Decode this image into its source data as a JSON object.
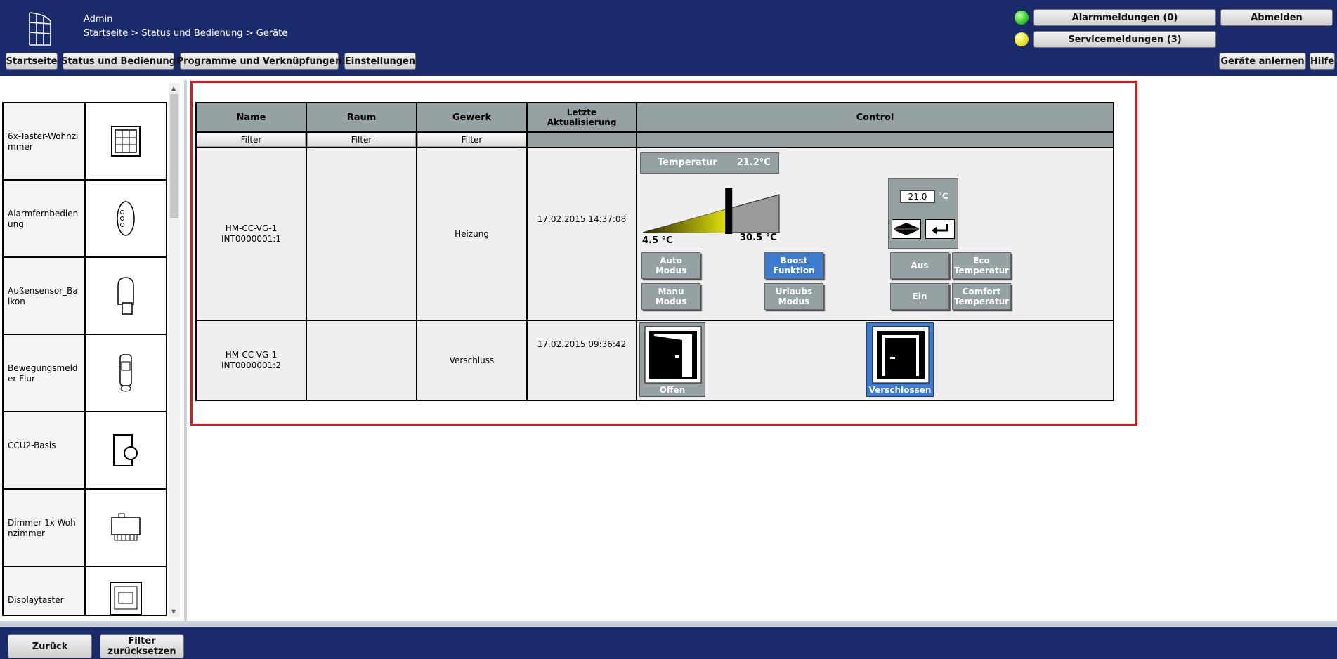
{
  "header": {
    "user": "Admin",
    "breadcrumb": "Startseite > Status und Bedienung > Geräte",
    "nav": [
      "Startseite",
      "Status und Bedienung",
      "Programme und Verknüpfungen",
      "Einstellungen"
    ],
    "alarm_label": "Alarmmeldungen (0)",
    "service_label": "Servicemeldungen (3)",
    "logout_label": "Abmelden",
    "learn_label": "Geräte anlernen",
    "help_label": "Hilfe",
    "led_colors": {
      "alarm": "#33cc22",
      "service": "#e8e020"
    }
  },
  "sidebar": {
    "devices": [
      {
        "name": "6x-Taster-Wohnzimmer",
        "icon": "wall-switch-icon"
      },
      {
        "name": "Alarmfernbedienung",
        "icon": "remote-control-icon"
      },
      {
        "name": "Außensensor_Balkon",
        "icon": "outdoor-sensor-icon"
      },
      {
        "name": "Bewegungsmelder Flur",
        "icon": "motion-detector-icon"
      },
      {
        "name": "CCU2-Basis",
        "icon": "ccu-base-icon"
      },
      {
        "name": "Dimmer 1x Wohnzimmer",
        "icon": "dimmer-module-icon"
      },
      {
        "name": "Displaytaster",
        "icon": "display-button-icon"
      }
    ]
  },
  "table": {
    "headers": [
      "Name",
      "Raum",
      "Gewerk",
      "Letzte Aktualisierung",
      "Control"
    ],
    "filter_label": "Filter",
    "rows": [
      {
        "name": "HM-CC-VG-1\nINT0000001:1",
        "room": "",
        "trade": "Heizung",
        "updated": "17.02.2015 14:37:08",
        "control": {
          "temp_label": "Temperatur",
          "temp_value": "21.2°C",
          "min_label": "4.5 °C",
          "max_label": "30.5 °C",
          "setpoint": "21.0",
          "setpoint_unit": "°C",
          "slider_level": 0.63,
          "buttons": {
            "auto": "Auto\nModus",
            "manu": "Manu\nModus",
            "boost": "Boost\nFunktion",
            "urlaub": "Urlaubs\nModus",
            "aus": "Aus",
            "ein": "Ein",
            "eco": "Eco\nTemperatur",
            "comfort": "Comfort\nTemperatur"
          },
          "active": "boost"
        }
      },
      {
        "name": "HM-CC-VG-1\nINT0000001:2",
        "room": "",
        "trade": "Verschluss",
        "updated": "17.02.2015 09:36:42",
        "control": {
          "open_label": "Offen",
          "closed_label": "Verschlossen",
          "active": "closed"
        }
      }
    ]
  },
  "footer": {
    "back_label": "Zurück",
    "reset_label": "Filter\nzurücksetzen"
  },
  "colors": {
    "navy": "#1b2a6b",
    "header_gray": "#95a1a3",
    "active_blue": "#3c7bd0",
    "highlight_red": "#e3151a"
  }
}
